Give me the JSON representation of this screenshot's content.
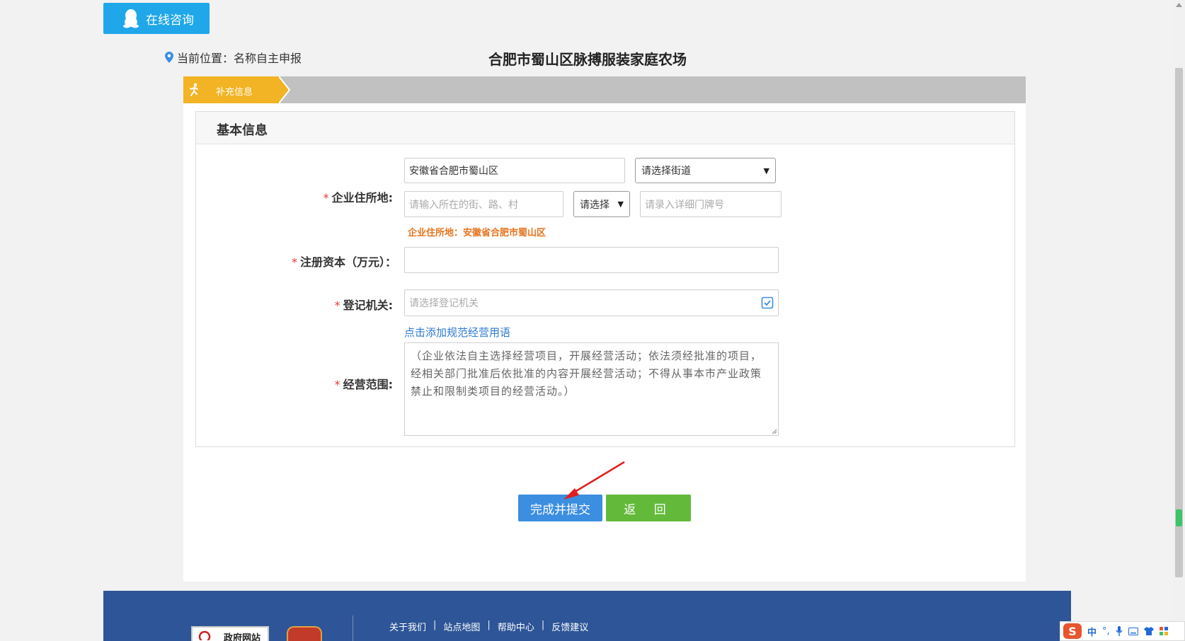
{
  "consult": {
    "label": "在线咨询",
    "icon": "qq-penguin-icon"
  },
  "breadcrumb": {
    "text": "当前位置：名称自主申报",
    "icon": "location-pin-icon"
  },
  "company_title": "合肥市蜀山区脉搏服装家庭农场",
  "steps": [
    {
      "label": "补充信息",
      "active": true,
      "icon": "running-person-icon"
    }
  ],
  "section": {
    "title": "基本信息"
  },
  "form": {
    "address": {
      "required_mark": "*",
      "label": "企业住所地:",
      "region_value": "安徽省合肥市蜀山区",
      "street_select": "请选择街道",
      "road_placeholder": "请输入所在的街、路、村",
      "type_select": "请选择",
      "number_placeholder": "请录入详细门牌号",
      "hint": "企业住所地：安徽省合肥市蜀山区"
    },
    "capital": {
      "required_mark": "*",
      "label": "注册资本（万元）：",
      "value": ""
    },
    "registry": {
      "required_mark": "*",
      "label": "登记机关:",
      "placeholder": "请选择登记机关",
      "icon": "select-checkbox-icon"
    },
    "scope": {
      "required_mark": "*",
      "label": "经营范围:",
      "add_link": "点击添加规范经营用语",
      "value": "（企业依法自主选择经营项目，开展经营活动；依法须经批准的项目，经相关部门批准后依批准的内容开展经营活动；不得从事本市产业政策禁止和限制类项目的经营活动。）"
    }
  },
  "buttons": {
    "submit": "完成并提交",
    "back": "返 回"
  },
  "footer": {
    "links": [
      "关于我们",
      "站点地图",
      "帮助中心",
      "反馈建议"
    ],
    "separator": "|",
    "gov_badge": "政府网站"
  },
  "ime": {
    "logo": "S",
    "mode": "中",
    "punct": "°,",
    "icons": [
      "microphone-icon",
      "keyboard-icon",
      "shirt-icon",
      "grid-icon"
    ]
  },
  "colors": {
    "consult_bg": "#1fa7ea",
    "step_active": "#f2b324",
    "required": "#e4393c",
    "hint": "#e8731d",
    "link": "#2e7ad2",
    "submit": "#3c8ee0",
    "back": "#62b93a",
    "footer": "#2d5597"
  }
}
